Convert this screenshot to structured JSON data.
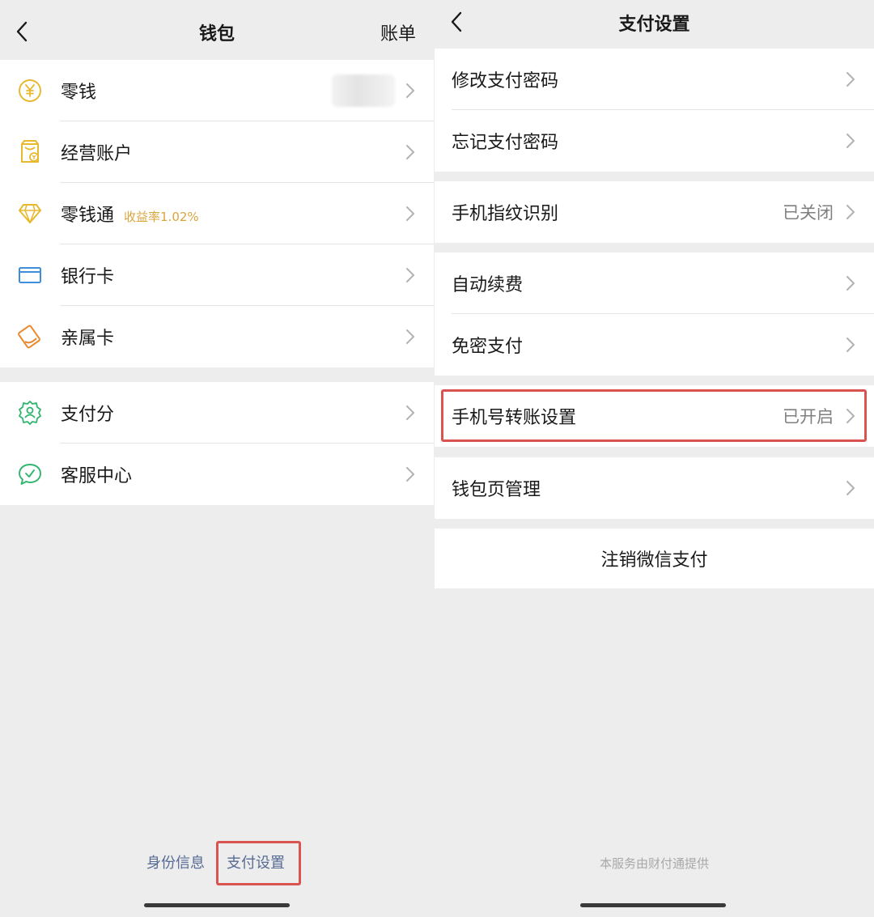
{
  "wallet": {
    "title": "钱包",
    "bill_label": "账单",
    "items": [
      {
        "label": "零钱"
      },
      {
        "label": "经营账户"
      },
      {
        "label": "零钱通",
        "tag": "收益率1.02%"
      },
      {
        "label": "银行卡"
      },
      {
        "label": "亲属卡"
      }
    ],
    "items2": [
      {
        "label": "支付分"
      },
      {
        "label": "客服中心"
      }
    ],
    "footer": {
      "identity_label": "身份信息",
      "pay_settings_label": "支付设置"
    }
  },
  "pay_settings": {
    "title": "支付设置",
    "group1": [
      {
        "label": "修改支付密码"
      },
      {
        "label": "忘记支付密码"
      }
    ],
    "group2": [
      {
        "label": "手机指纹识别",
        "value": "已关闭"
      }
    ],
    "group3": [
      {
        "label": "自动续费"
      },
      {
        "label": "免密支付"
      }
    ],
    "group4": [
      {
        "label": "手机号转账设置",
        "value": "已开启"
      }
    ],
    "group5": [
      {
        "label": "钱包页管理"
      }
    ],
    "logout_label": "注销微信支付",
    "footer_note": "本服务由财付通提供"
  },
  "colors": {
    "link": "#576b95",
    "highlight": "#d9534f",
    "icon_yellow": "#e8b92e",
    "icon_blue": "#3d8fd9",
    "icon_orange": "#e98a2f",
    "icon_green": "#2fb56e",
    "tag": "#d9a53c"
  }
}
